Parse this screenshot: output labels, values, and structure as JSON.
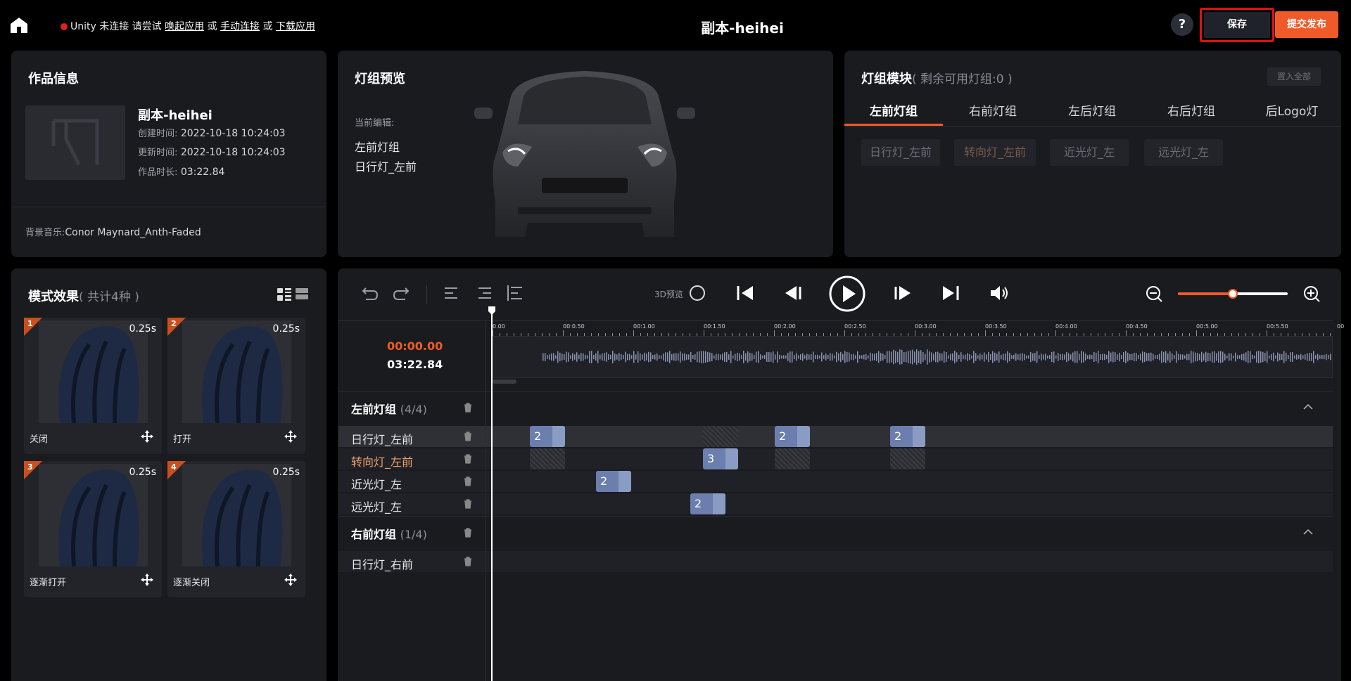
{
  "header": {
    "title": "副本-heihei",
    "unity_status": "Unity 未连接 请尝试",
    "link_wake": "唤起应用",
    "or1": "或",
    "link_manual": "手动连接",
    "or2": "或",
    "link_download": "下载应用",
    "help_label": "?",
    "save_label": "保存",
    "publish_label": "提交发布"
  },
  "info": {
    "heading": "作品信息",
    "name": "副本-heihei",
    "created_label": "创建时间:",
    "created": "2022-10-18 10:24:03",
    "updated_label": "更新时间:",
    "updated": "2022-10-18 10:24:03",
    "duration_label": "作品时长:",
    "duration": "03:22.84",
    "music_label": "背景音乐:",
    "music": "Conor Maynard_Anth-Faded"
  },
  "preview": {
    "heading": "灯组预览",
    "editing_label": "当前编辑:",
    "group": "左前灯组",
    "light": "日行灯_左前"
  },
  "module": {
    "heading": "灯组模块",
    "remaining": "( 剩余可用灯组:0 )",
    "set_all": "置入全部",
    "tabs": [
      "左前灯组",
      "右前灯组",
      "左后灯组",
      "右后灯组",
      "后Logo灯"
    ],
    "active_tab": 0,
    "chips": [
      "日行灯_左前",
      "转向灯_左前",
      "近光灯_左",
      "远光灯_左"
    ]
  },
  "effects": {
    "heading": "模式效果",
    "count": "( 共计4种 )",
    "items": [
      {
        "num": "1",
        "duration": "0.25s",
        "label": "关闭"
      },
      {
        "num": "2",
        "duration": "0.25s",
        "label": "打开"
      },
      {
        "num": "3",
        "duration": "0.25s",
        "label": "逐渐打开"
      },
      {
        "num": "4",
        "duration": "0.25s",
        "label": "逐渐关闭"
      }
    ]
  },
  "timeline": {
    "preview3d_label": "3D预览",
    "current_time": "00:00.00",
    "total_time": "03:22.84",
    "zoom_level": 0.5,
    "ruler": [
      "0.00",
      "00:0.50",
      "00:1.00",
      "00:1.50",
      "00:2.00",
      "00:2.50",
      "00:3.00",
      "00:3.50",
      "00:4.00",
      "00:4.50",
      "00:5.00",
      "00:5.50",
      "00"
    ],
    "groups": [
      {
        "name": "左前灯组",
        "count": "(4/4)",
        "tracks": [
          {
            "name": "日行灯_左前",
            "highlight": false,
            "blocks": [
              "2",
              "2",
              "2"
            ]
          },
          {
            "name": "转向灯_左前",
            "highlight": true,
            "blocks": [
              "3"
            ]
          },
          {
            "name": "近光灯_左",
            "highlight": false,
            "blocks": [
              "2"
            ]
          },
          {
            "name": "远光灯_左",
            "highlight": false,
            "blocks": [
              "2"
            ]
          }
        ]
      },
      {
        "name": "右前灯组",
        "count": "(1/4)",
        "tracks": [
          {
            "name": "日行灯_右前",
            "highlight": false,
            "blocks": []
          }
        ]
      }
    ]
  },
  "colors": {
    "accent": "#f05a28",
    "panel": "#1a1b1f",
    "block": "#6b7eae",
    "highlight_text": "#f0a070"
  }
}
